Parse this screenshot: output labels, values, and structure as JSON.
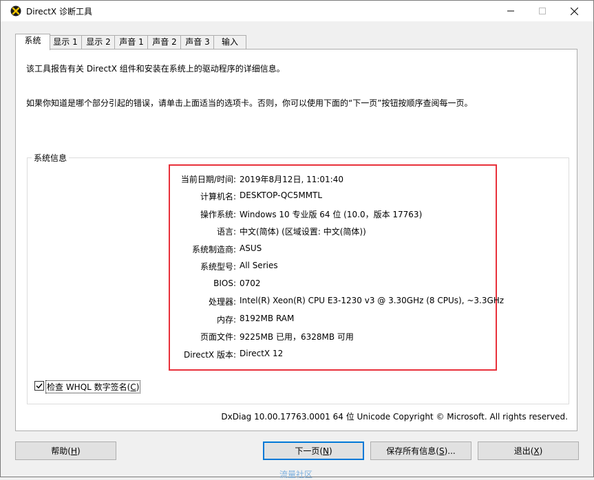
{
  "window": {
    "title": "DirectX 诊断工具"
  },
  "tabs": [
    {
      "label": "系统"
    },
    {
      "label": "显示 1"
    },
    {
      "label": "显示 2"
    },
    {
      "label": "声音 1"
    },
    {
      "label": "声音 2"
    },
    {
      "label": "声音 3"
    },
    {
      "label": "输入"
    }
  ],
  "intro": {
    "line1": "该工具报告有关 DirectX 组件和安装在系统上的驱动程序的详细信息。",
    "line2": "如果你知道是哪个部分引起的错误，请单击上面适当的选项卡。否则，你可以使用下面的“下一页”按钮按顺序查阅每一页。"
  },
  "system_info": {
    "group_label": "系统信息",
    "rows": [
      {
        "label": "当前日期/时间:",
        "value": "2019年8月12日, 11:01:40"
      },
      {
        "label": "计算机名:",
        "value": "DESKTOP-QC5MMTL"
      },
      {
        "label": "操作系统:",
        "value": "Windows 10 专业版 64 位 (10.0，版本 17763)"
      },
      {
        "label": "语言:",
        "value": "中文(简体) (区域设置: 中文(简体))"
      },
      {
        "label": "系统制造商:",
        "value": "ASUS"
      },
      {
        "label": "系统型号:",
        "value": "All Series"
      },
      {
        "label": "BIOS:",
        "value": "0702"
      },
      {
        "label": "处理器:",
        "value": "Intel(R) Xeon(R) CPU E3-1230 v3 @ 3.30GHz (8 CPUs), ~3.3GHz"
      },
      {
        "label": "内存:",
        "value": "8192MB RAM"
      },
      {
        "label": "页面文件:",
        "value": "9225MB 已用，6328MB 可用"
      },
      {
        "label": "DirectX 版本:",
        "value": "DirectX 12"
      }
    ]
  },
  "whql": {
    "label_prefix": "检查 WHQL 数字签名(",
    "label_key": "C",
    "label_suffix": ")",
    "checked": true
  },
  "footer_info": "DxDiag 10.00.17763.0001 64 位 Unicode  Copyright © Microsoft. All rights reserved.",
  "buttons": {
    "help": {
      "text": "帮助(",
      "key": "H",
      "end": ")"
    },
    "next": {
      "text": "下一页(",
      "key": "N",
      "end": ")"
    },
    "save": {
      "text": "保存所有信息(",
      "key": "S",
      "end": ")..."
    },
    "exit": {
      "text": "退出(",
      "key": "X",
      "end": ")"
    }
  },
  "watermark": "流量社区",
  "colors": {
    "highlight_border": "#e8303a",
    "default_button_border": "#0078d7"
  }
}
